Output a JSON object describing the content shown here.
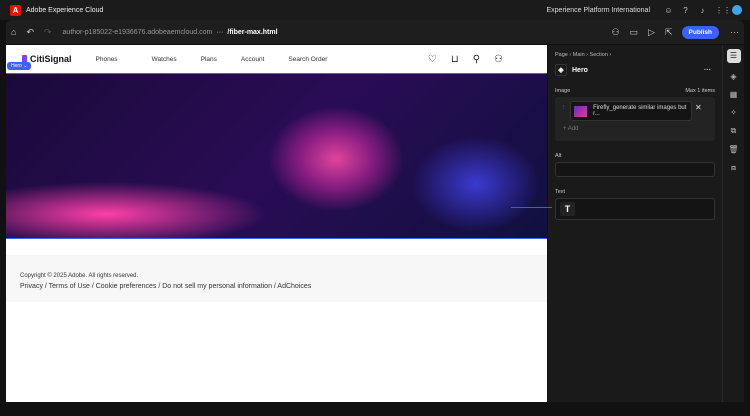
{
  "app": {
    "title": "Adobe Experience Cloud",
    "org": "Experience Platform International"
  },
  "toolbar": {
    "host": "author-p185022-e1936676.adobeaemcloud.com",
    "path": "/fiber-max.html",
    "publish": "Publish"
  },
  "site": {
    "brand": "CitiSignal",
    "nav": [
      "Phones",
      "Watches",
      "Plans",
      "Account",
      "Search Order"
    ],
    "tag": "Hero ⌄",
    "copyright": "Copyright © 2025 Adobe. All rights reserved.",
    "links": "Privacy / Terms of Use / Cookie preferences / Do not sell my personal information / AdChoices"
  },
  "panel": {
    "breadcrumb": "Page  ›  Main  ›  Section  ›",
    "component": "Hero",
    "image_label": "Image",
    "max_items": "Max 1 items",
    "image_name": "Firefly_generate similar images but r...",
    "add": "Add",
    "alt_label": "Alt",
    "text_label": "Text"
  }
}
